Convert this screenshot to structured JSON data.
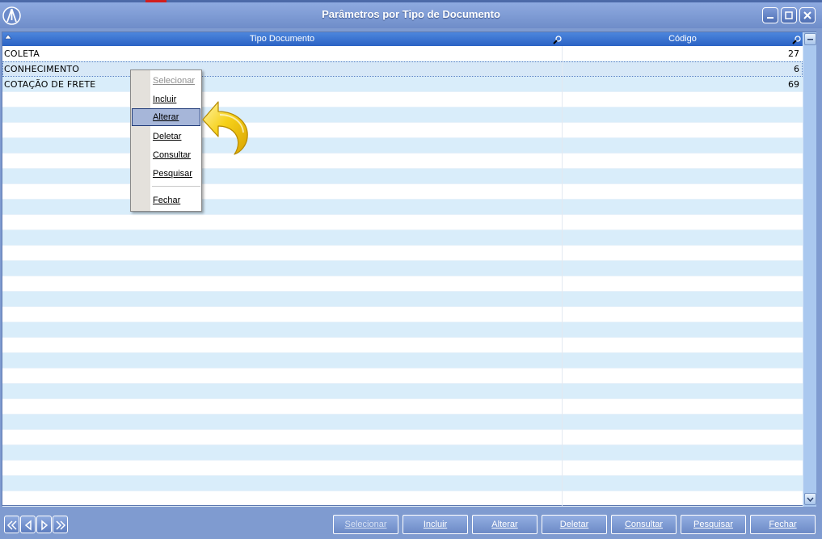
{
  "window": {
    "title": "Parâmetros por Tipo de Documento",
    "logo_icon": "compass-logo-icon",
    "controls": [
      "minimize-icon",
      "maximize-icon",
      "close-icon"
    ]
  },
  "grid": {
    "columns": [
      {
        "label": "Tipo Documento",
        "filter_icon": "magnifier-icon"
      },
      {
        "label": "Código",
        "filter_icon": "magnifier-icon"
      }
    ],
    "rows": [
      {
        "tipo": "COLETA",
        "codigo": "27"
      },
      {
        "tipo": "CONHECIMENTO",
        "codigo": "6",
        "selected": true
      },
      {
        "tipo": "COTAÇÃO DE FRETE",
        "codigo": "69"
      }
    ],
    "row_stripe_color": "#d9edfa",
    "header_color": "#2b63c4"
  },
  "context_menu": {
    "items": [
      {
        "label": "Selecionar",
        "disabled": true
      },
      {
        "label": "Incluir"
      },
      {
        "label": "Alterar",
        "highlighted": true
      },
      {
        "label": "Deletar"
      },
      {
        "label": "Consultar"
      },
      {
        "label": "Pesquisar"
      },
      {
        "label": "Fechar"
      }
    ],
    "pointer_icon": "curved-arrow-icon",
    "pointer_color": "#f6d11a"
  },
  "navigator": [
    "first-record-icon",
    "previous-record-icon",
    "next-record-icon",
    "last-record-icon"
  ],
  "actions": {
    "selecionar": "Selecionar",
    "incluir": "Incluir",
    "alterar": "Alterar",
    "deletar": "Deletar",
    "consultar": "Consultar",
    "pesquisar": "Pesquisar",
    "fechar": "Fechar"
  }
}
